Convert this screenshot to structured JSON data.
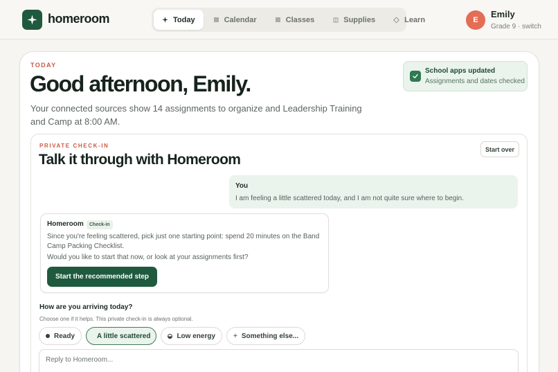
{
  "brand": {
    "name": "homeroom",
    "icon": "sparkle-icon",
    "color": "#1f5a3f"
  },
  "nav": [
    {
      "label": "Today",
      "icon": "sparkle-icon",
      "active": true
    },
    {
      "label": "Calendar",
      "icon": "square-icon",
      "active": false
    },
    {
      "label": "Classes",
      "icon": "square-icon",
      "active": false
    },
    {
      "label": "Supplies",
      "icon": "box-icon",
      "active": false
    },
    {
      "label": "Learn",
      "icon": "diamond-icon",
      "active": false
    }
  ],
  "user": {
    "initial": "E",
    "name": "Emily",
    "subtitle": "Grade 9 · switch",
    "avatar_color": "#e36d55"
  },
  "today": {
    "eyebrow": "TODAY",
    "greeting": "Good afternoon, Emily.",
    "intro": "Your connected sources show 14 assignments to organize and Leadership Training and Camp at 8:00 AM."
  },
  "sync": {
    "title": "School apps updated",
    "subtitle": "Assignments and dates checked"
  },
  "checkin": {
    "eyebrow": "PRIVATE CHECK-IN",
    "title": "Talk it through with Homeroom",
    "start_over": "Start over",
    "user_message": {
      "label": "You",
      "text": "I am feeling a little scattered today, and I am not quite sure where to begin."
    },
    "assistant_message": {
      "name": "Homeroom",
      "badge": "Check-in",
      "text1": "Since you're feeling scattered, pick just one starting point: spend 20 minutes on the Band Camp Packing Checklist.",
      "text2": "Would you like to start that now, or look at your assignments first?",
      "button": "Start the recommended step"
    },
    "arrival": {
      "title": "How are you arriving today?",
      "subtitle": "Choose one if it helps. This private check-in is always optional.",
      "options": [
        {
          "label": "Ready",
          "icon": "dot-icon",
          "selected": false
        },
        {
          "label": "A little scattered",
          "icon": "",
          "selected": true
        },
        {
          "label": "Low energy",
          "icon": "half-circle-icon",
          "selected": false
        },
        {
          "label": "Something else...",
          "icon": "plus-icon",
          "selected": false
        }
      ]
    },
    "reply_placeholder": "Reply to Homeroom..."
  }
}
